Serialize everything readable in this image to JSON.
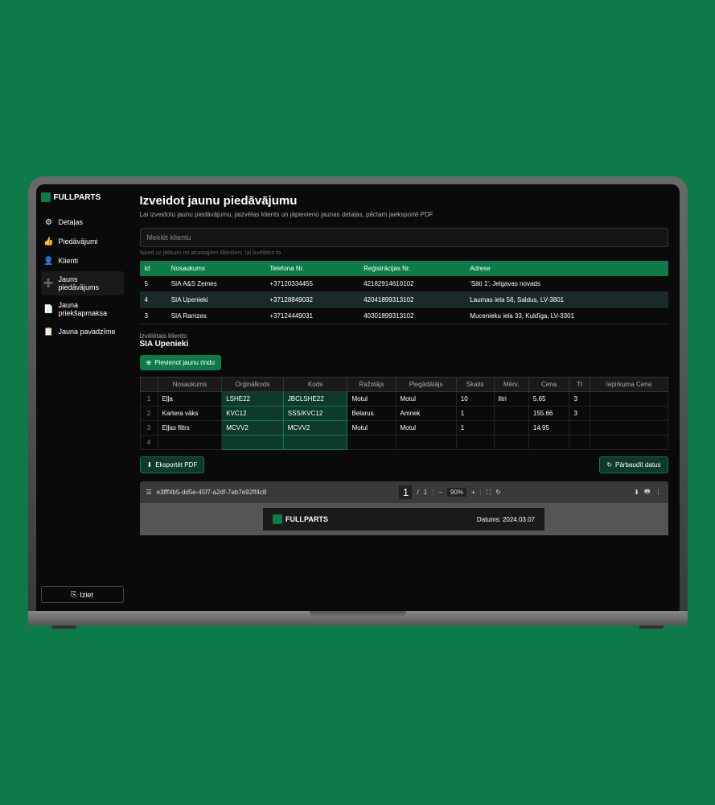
{
  "brand": "FULLPARTS",
  "sidebar": {
    "items": [
      {
        "icon": "⚙",
        "label": "Detaļas"
      },
      {
        "icon": "👍",
        "label": "Piedāvājumi"
      },
      {
        "icon": "👤",
        "label": "Klienti"
      },
      {
        "icon": "➕",
        "label": "Jauns piedāvājums"
      },
      {
        "icon": "📄",
        "label": "Jauna priekšapmaksa"
      },
      {
        "icon": "📋",
        "label": "Jauna pavadzīme"
      }
    ],
    "logout": "Iziet"
  },
  "page": {
    "title": "Izveidot jaunu piedāvājumu",
    "subtitle": "Lai izveidotu jaunu piedāvājumu, jaizvēlas klients un jāpievieno jaunas detaļas, pēctam jaeksportē PDF",
    "search_placeholder": "Meklēt klientu",
    "search_hint": "Spied uz jebkuru no atrastajiem klientiem, lai izvēlētos to"
  },
  "clients": {
    "headers": {
      "id": "Id",
      "name": "Nosaukums",
      "phone": "Telefona Nr.",
      "reg": "Reģistrācijas Nr.",
      "addr": "Adrese"
    },
    "rows": [
      {
        "id": "5",
        "name": "SIA A&S Zemes",
        "phone": "+37120334455",
        "reg": "42182914610102",
        "addr": "'Sāti 1', Jelgavas novads"
      },
      {
        "id": "4",
        "name": "SIA Upenieki",
        "phone": "+37128849032",
        "reg": "42041899313102",
        "addr": "Laumas iela 56, Saldus, LV-3801"
      },
      {
        "id": "3",
        "name": "SIA Ramzes",
        "phone": "+37124449031",
        "reg": "40301899313102",
        "addr": "Mucenieku iela 33, Kuldīga, LV-3301"
      }
    ]
  },
  "selected": {
    "label": "Izvēlētais klients:",
    "name": "SIA Upenieki"
  },
  "add_row": "Pievienot jaunu rindu",
  "products": {
    "headers": [
      "",
      "Nosaukums",
      "Orģinālkods",
      "Kods",
      "Ražotājs",
      "Piegādātājs",
      "Skaits",
      "Mērv.",
      "Cena",
      "Tt",
      "Iepirkuma Cena"
    ],
    "rows": [
      {
        "n": "1",
        "name": "Eļļa",
        "orig": "LSHE22",
        "code": "JBCLSHE22",
        "maker": "Motul",
        "supplier": "Motul",
        "qty": "10",
        "unit": "litri",
        "price": "5.65",
        "tt": "3"
      },
      {
        "n": "2",
        "name": "Kartera vāks",
        "orig": "KVC12",
        "code": "SSS/KVC12",
        "maker": "Belarus",
        "supplier": "Amnek",
        "qty": "1",
        "unit": "",
        "price": "155.66",
        "tt": "3"
      },
      {
        "n": "3",
        "name": "Eļļas filtrs",
        "orig": "MCVV2",
        "code": "MCVV2",
        "maker": "Motul",
        "supplier": "Motul",
        "qty": "1",
        "unit": "",
        "price": "14.95",
        "tt": ""
      },
      {
        "n": "4",
        "name": "",
        "orig": "",
        "code": "",
        "maker": "",
        "supplier": "",
        "qty": "",
        "unit": "",
        "price": "",
        "tt": ""
      }
    ]
  },
  "actions": {
    "export": "Eksportēt PDF",
    "check": "Pārbaudīt datus"
  },
  "pdf": {
    "filename": "e3fff4b5-dd5e-45f7-a2df-7ab7e92ff4c8",
    "page": "1",
    "total": "1",
    "zoom": "90%",
    "brand": "FULLPARTS",
    "date_label": "Datums:",
    "date": "2024.03.07"
  }
}
